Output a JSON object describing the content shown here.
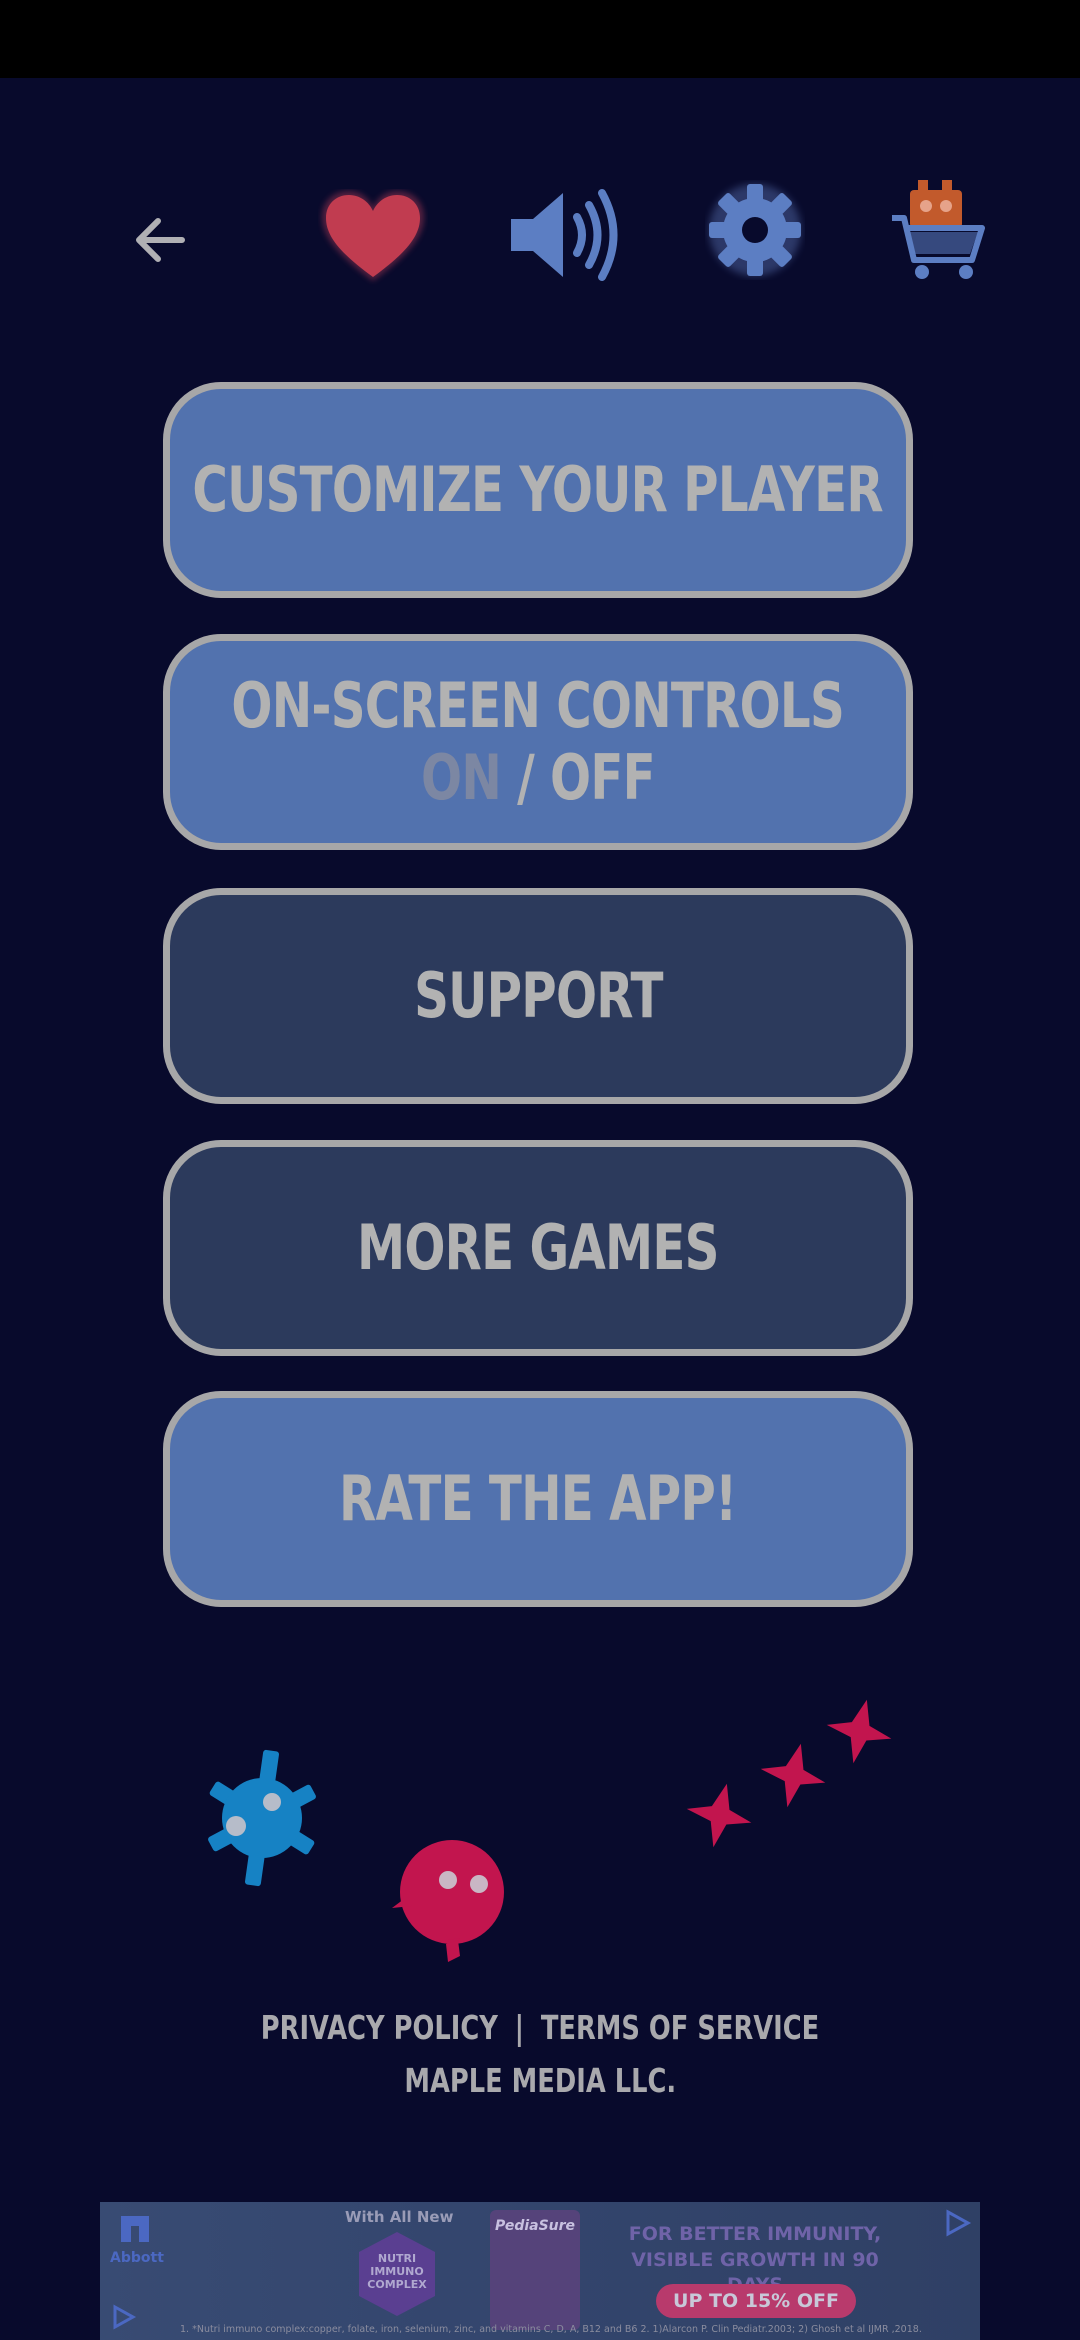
{
  "colors": {
    "background": "#080a2c",
    "button_light": "#5272ae",
    "button_dark": "#2c3a5c",
    "button_text": "#b2b2b2",
    "heart": "#c13c50",
    "sound": "#5c7ec3",
    "gear": "#5c7ec3",
    "blue_monster": "#1682c4",
    "pink_monster": "#c2154e"
  },
  "topbar": {
    "back_icon": "arrow-left",
    "favorite_icon": "heart",
    "sound_icon": "speaker-on",
    "settings_icon": "gear",
    "shop_icon": "shopping-cart"
  },
  "menu": {
    "customize_label": "CUSTOMIZE YOUR PLAYER",
    "controls_label": "ON-SCREEN CONTROLS",
    "controls_on": "ON",
    "controls_sep": " / ",
    "controls_off": "OFF",
    "support_label": "SUPPORT",
    "more_games_label": "MORE GAMES",
    "rate_label": "RATE THE APP!"
  },
  "footer": {
    "privacy": "PRIVACY POLICY",
    "separator": "|",
    "terms": "TERMS OF SERVICE",
    "company": "MAPLE MEDIA LLC."
  },
  "ad": {
    "brand": "Abbott",
    "with_all_new": "With All New",
    "hex_text": "NUTRI IMMUNO COMPLEX",
    "product": "PediaSure",
    "headline_line1": "FOR BETTER IMMUNITY,",
    "headline_line2": "VISIBLE GROWTH IN 90 DAYS",
    "offer": "UP TO 15% OFF",
    "fine_print": "1. *Nutri immuno complex:copper, folate, iron, selenium, zinc, and vitamins C, D, A, B12 and B6 2. 1)Alarcon P. Clin Pediatr.2003; 2) Ghosh et al IJMR ,2018."
  }
}
